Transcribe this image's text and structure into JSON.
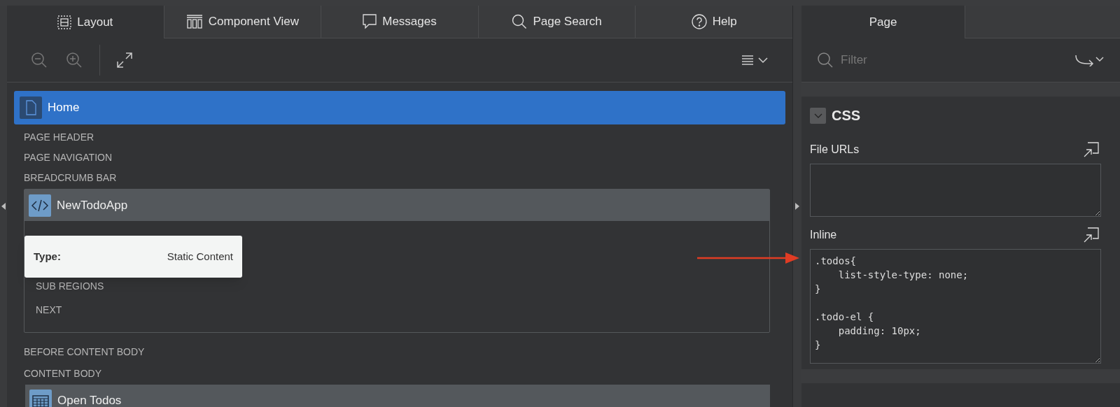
{
  "tabs": [
    {
      "label": "Layout",
      "kind": "layout",
      "selected": true
    },
    {
      "label": "Component View",
      "kind": "components",
      "selected": false
    },
    {
      "label": "Messages",
      "kind": "messages",
      "selected": false
    },
    {
      "label": "Page Search",
      "kind": "search",
      "selected": false
    },
    {
      "label": "Help",
      "kind": "help",
      "selected": false
    }
  ],
  "tree": {
    "page": {
      "label": "Home",
      "selected": true
    },
    "sections_top": [
      "PAGE HEADER",
      "PAGE NAVIGATION",
      "BREADCRUMB BAR"
    ],
    "region": {
      "label": "NewTodoApp",
      "sections": [
        "SUB REGIONS",
        "NEXT"
      ]
    },
    "tooltip": {
      "key": "Type:",
      "value": "Static Content"
    },
    "sections_bottom": [
      "BEFORE CONTENT BODY",
      "CONTENT BODY"
    ],
    "region2": {
      "label": "Open Todos"
    }
  },
  "right_tabs": [
    {
      "label": "Page",
      "selected": true
    }
  ],
  "filter": {
    "placeholder": "Filter"
  },
  "css_group": {
    "title": "CSS",
    "expanded": true,
    "fields": [
      {
        "label": "File URLs"
      },
      {
        "label": "Inline",
        "value": ".todos{\n    list-style-type: none;\n}\n\n.todo-el {\n    padding: 10px;\n}"
      }
    ]
  }
}
